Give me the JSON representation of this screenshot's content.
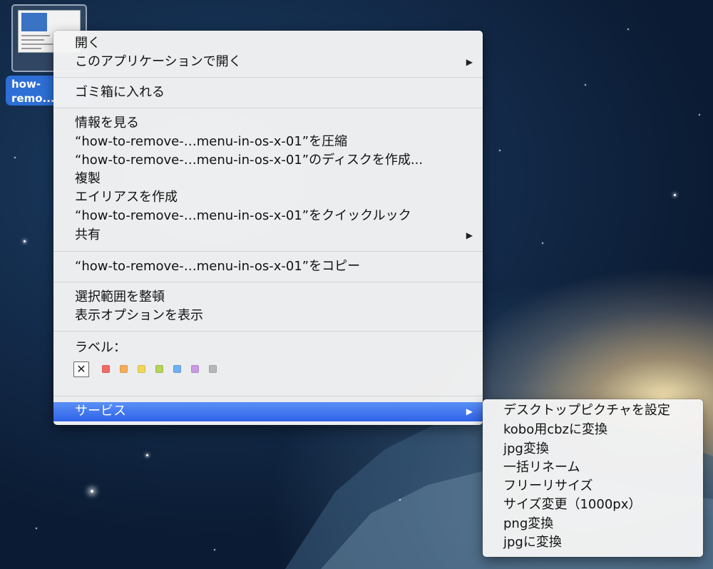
{
  "desktop": {
    "file_icon": {
      "label": "how-\nremo..."
    }
  },
  "menu": {
    "open": "開く",
    "open_with": "このアプリケーションで開く",
    "move_to_trash": "ゴミ箱に入れる",
    "get_info": "情報を見る",
    "compress": "“how-to-remove-…menu-in-os-x-01”を圧縮",
    "burn": "“how-to-remove-…menu-in-os-x-01”のディスクを作成...",
    "duplicate": "複製",
    "make_alias": "エイリアスを作成",
    "quick_look": "“how-to-remove-…menu-in-os-x-01”をクイックルック",
    "share": "共有",
    "copy": "“how-to-remove-…menu-in-os-x-01”をコピー",
    "clean_up": "選択範囲を整頓",
    "view_options": "表示オプションを表示",
    "label_heading": "ラベル：",
    "services": "サービス",
    "submenu_arrow": "▶",
    "label_none_glyph": "✕",
    "label_colors": [
      "#f26b66",
      "#f6ad54",
      "#f2d65a",
      "#b7d35a",
      "#6fb0f2",
      "#c99ae6",
      "#b7b7b7"
    ]
  },
  "services_submenu": {
    "items": [
      "デスクトップピクチャを設定",
      "kobo用cbzに変換",
      "jpg変換",
      "一括リネーム",
      "フリーリサイズ",
      "サイズ変更（1000px）",
      "png変換",
      "jpgに変換"
    ]
  },
  "colors": {
    "highlight": "#3a70ee",
    "selection_label": "#2d6fd6"
  }
}
